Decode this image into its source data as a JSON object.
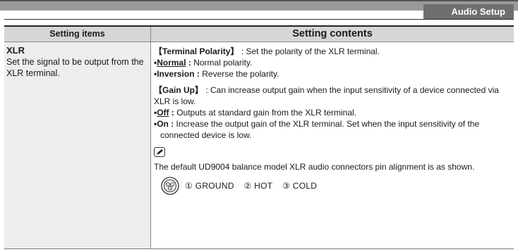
{
  "section_tab": "Audio Setup",
  "table": {
    "col1_header": "Setting items",
    "col2_header": "Setting contents"
  },
  "item": {
    "title": "XLR",
    "description": "Set the signal to be output from the XLR terminal."
  },
  "terminal_polarity": {
    "heading": "【Terminal Polarity】",
    "heading_desc": " : Set the polarity of the XLR terminal.",
    "options": [
      {
        "label": "Normal",
        "sep": " : ",
        "desc": "Normal polarity.",
        "default": true
      },
      {
        "label": "Inversion",
        "sep": " : ",
        "desc": "Reverse the polarity.",
        "default": false
      }
    ]
  },
  "gain_up": {
    "heading": "【Gain Up】",
    "heading_desc": " : Can increase output gain when the input sensitivity of a device connected via XLR is low.",
    "options": [
      {
        "label": "Off",
        "sep": " : ",
        "desc": "Outputs at standard gain from the XLR terminal.",
        "default": true
      },
      {
        "label": "On",
        "sep": " : ",
        "desc": "Increase the output gain of the XLR terminal. Set when the input sensitivity of the connected device is low.",
        "default": false
      }
    ]
  },
  "note": {
    "icon": "pencil-note-icon",
    "text": "The default UD9004 balance model XLR audio connectors pin alignment is as shown."
  },
  "pins": {
    "icon": "xlr-connector-icon",
    "labels": [
      "① GROUND",
      "② HOT",
      "③ COLD"
    ]
  }
}
